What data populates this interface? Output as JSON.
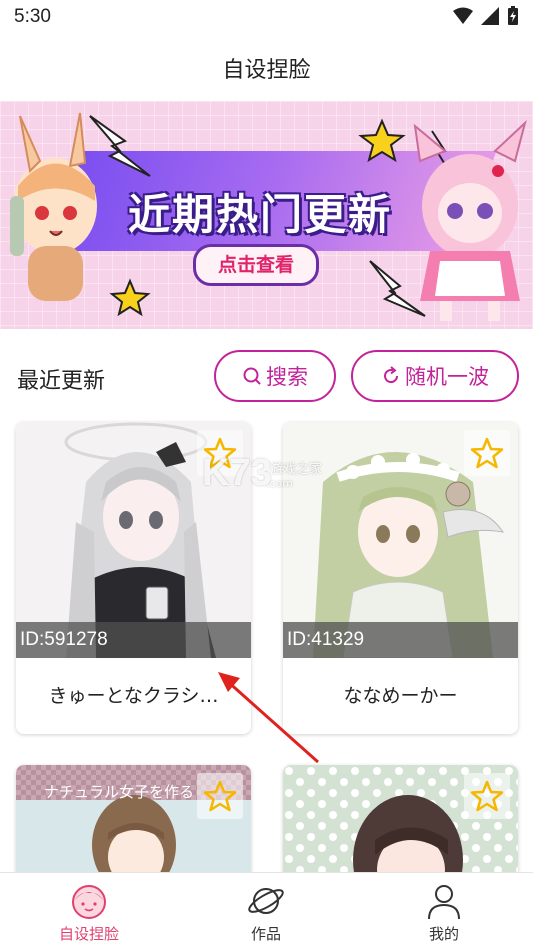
{
  "status": {
    "time": "5:30"
  },
  "header": {
    "title": "自设捏脸"
  },
  "banner": {
    "title": "近期热门更新",
    "button_label": "点击查看"
  },
  "section": {
    "title": "最近更新",
    "search_label": "搜索",
    "random_label": "随机一波"
  },
  "cards": [
    {
      "id_label": "ID:591278",
      "name": "きゅーとなクラシ…",
      "starred": false
    },
    {
      "id_label": "ID:41329",
      "name": "ななめーかー",
      "starred": false
    },
    {
      "caption": "ナチュラル女子を作る",
      "starred": false
    },
    {
      "starred": false
    }
  ],
  "watermark": {
    "logo": "K73",
    "sub": "游戏之家",
    "url": ".com"
  },
  "nav": {
    "items": [
      {
        "label": "自设捏脸",
        "active": true
      },
      {
        "label": "作品",
        "active": false
      },
      {
        "label": "我的",
        "active": false
      }
    ]
  },
  "colors": {
    "accent": "#c2239a",
    "star": "#f5b700",
    "nav_active": "#e0416f",
    "nav_inactive": "#333333"
  }
}
